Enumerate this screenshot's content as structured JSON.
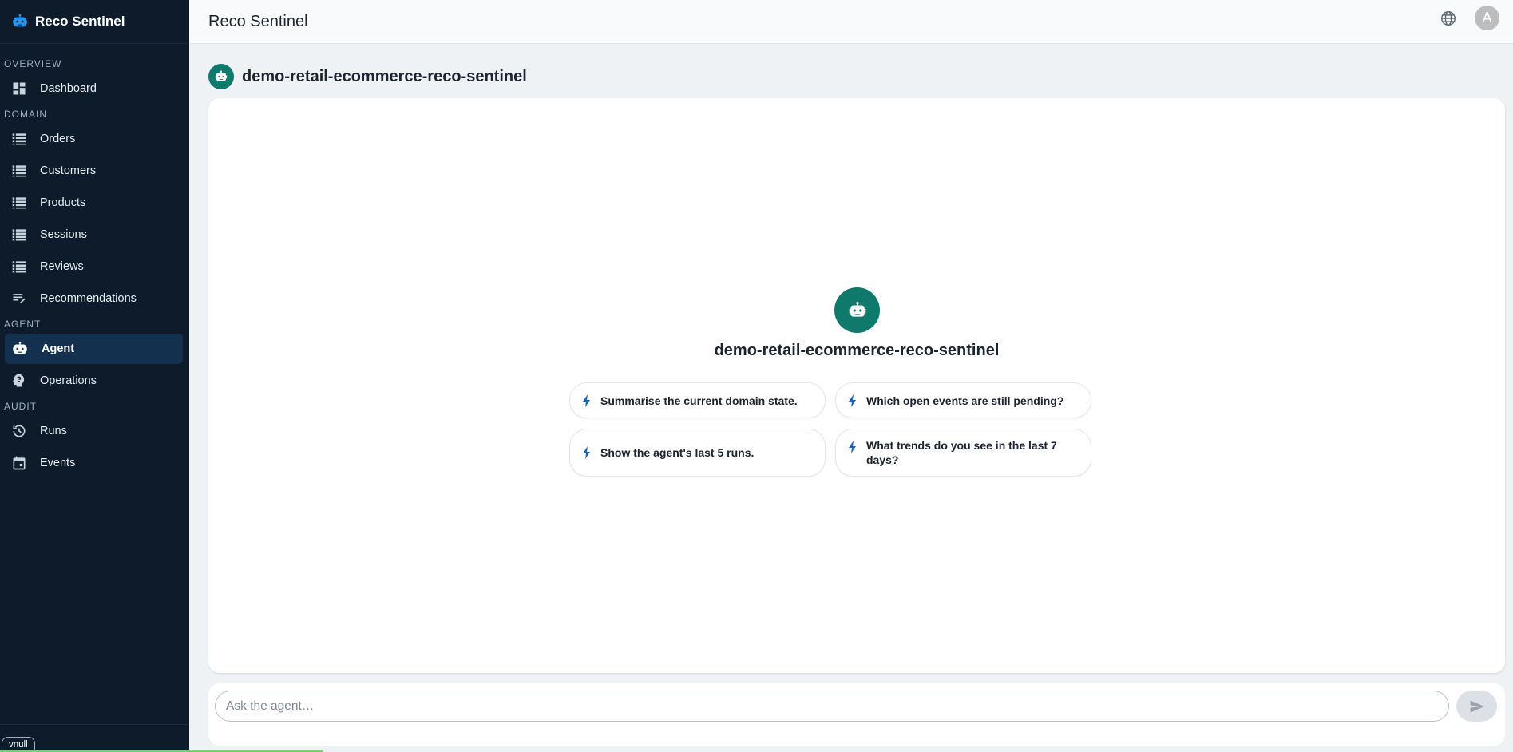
{
  "app": {
    "name": "Reco Sentinel"
  },
  "sidebar": {
    "sections": [
      {
        "label": "OVERVIEW",
        "items": [
          {
            "label": "Dashboard",
            "icon": "dashboard-icon"
          }
        ]
      },
      {
        "label": "DOMAIN",
        "items": [
          {
            "label": "Orders",
            "icon": "list-icon"
          },
          {
            "label": "Customers",
            "icon": "list-icon"
          },
          {
            "label": "Products",
            "icon": "list-icon"
          },
          {
            "label": "Sessions",
            "icon": "list-icon"
          },
          {
            "label": "Reviews",
            "icon": "list-icon"
          },
          {
            "label": "Recommendations",
            "icon": "edit-list-icon"
          }
        ]
      },
      {
        "label": "AGENT",
        "items": [
          {
            "label": "Agent",
            "icon": "robot-icon",
            "active": true
          },
          {
            "label": "Operations",
            "icon": "psychology-icon"
          }
        ]
      },
      {
        "label": "AUDIT",
        "items": [
          {
            "label": "Runs",
            "icon": "history-icon"
          },
          {
            "label": "Events",
            "icon": "calendar-icon"
          }
        ]
      }
    ],
    "footer_chip": "vnull"
  },
  "topbar": {
    "title": "Reco Sentinel",
    "avatar_letter": "A",
    "icons": [
      "globe-icon"
    ]
  },
  "main": {
    "agent_name": "demo-retail-ecommerce-reco-sentinel",
    "hero_title": "demo-retail-ecommerce-reco-sentinel",
    "suggestions": [
      "Summarise the current domain state.",
      "Which open events are still pending?",
      "Show the agent's last 5 runs.",
      "What trends do you see in the last 7 days?"
    ],
    "composer": {
      "placeholder": "Ask the agent…",
      "value": ""
    }
  },
  "colors": {
    "sidebar_bg": "#0d1b2a",
    "accent": "#0f7a6c",
    "active_bg": "#13304f",
    "bolt": "#1565c0"
  }
}
